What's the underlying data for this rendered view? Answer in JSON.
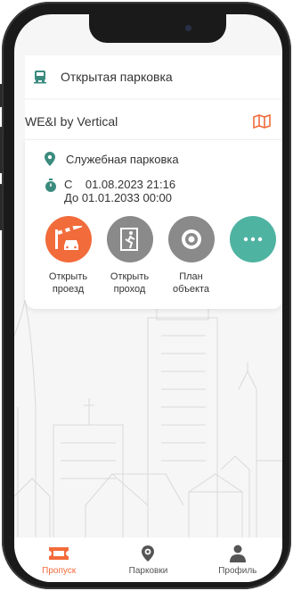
{
  "colors": {
    "accent": "#f26b3a",
    "teal": "#4fb3a2",
    "gray_button": "#8a8a8a",
    "icon_teal": "#3a8b7e"
  },
  "parking_type": {
    "label": "Открытая парковка",
    "icon": "bus-icon"
  },
  "object": {
    "name": "WE&I by Vertical",
    "map_icon": "map-icon"
  },
  "pass": {
    "parking_label": "Служебная парковка",
    "from_prefix": "С",
    "from_date": "01.08.2023 21:16",
    "to_prefix": "До",
    "to_date": "01.01.2033 00:00"
  },
  "actions": [
    {
      "label_line1": "Открыть",
      "label_line2": "проезд",
      "icon": "barrier-icon"
    },
    {
      "label_line1": "Открыть",
      "label_line2": "проход",
      "icon": "door-icon"
    },
    {
      "label_line1": "План",
      "label_line2": "объекта",
      "icon": "target-icon"
    },
    {
      "label_line1": "",
      "label_line2": "",
      "icon": "more-icon"
    }
  ],
  "tabs": [
    {
      "label": "Пропуск",
      "icon": "ticket-icon",
      "active": true
    },
    {
      "label": "Парковки",
      "icon": "parking-pin-icon",
      "active": false
    },
    {
      "label": "Профиль",
      "icon": "user-icon",
      "active": false
    }
  ]
}
